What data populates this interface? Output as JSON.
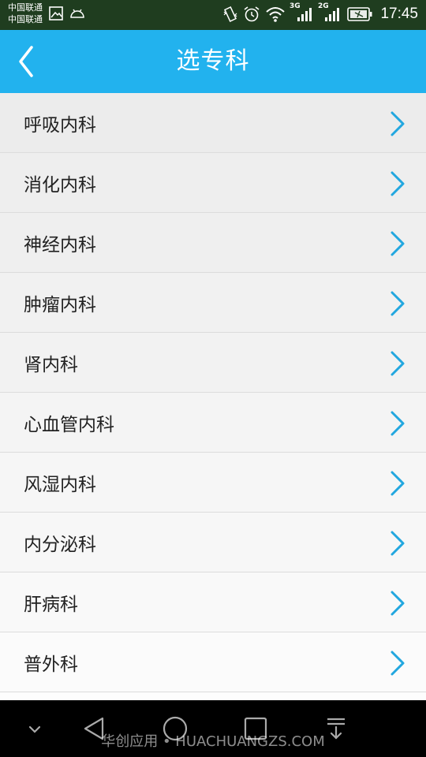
{
  "status_bar": {
    "carrier_1": "中国联通",
    "carrier_2": "中国联通",
    "net_1": "3G",
    "net_2": "2G",
    "time": "17:45"
  },
  "header": {
    "title": "选专科",
    "back_icon": "chevron-left-icon"
  },
  "departments": [
    "呼吸内科",
    "消化内科",
    "神经内科",
    "肿瘤内科",
    "肾内科",
    "心血管内科",
    "风湿内科",
    "内分泌科",
    "肝病科",
    "普外科"
  ],
  "colors": {
    "header_bg": "#22b2ee",
    "chevron": "#22a7df",
    "status_bar_bg": "#1f3d1f"
  },
  "nav_bar": {
    "watermark": "华创应用 • HUACHUANGZS.COM"
  }
}
